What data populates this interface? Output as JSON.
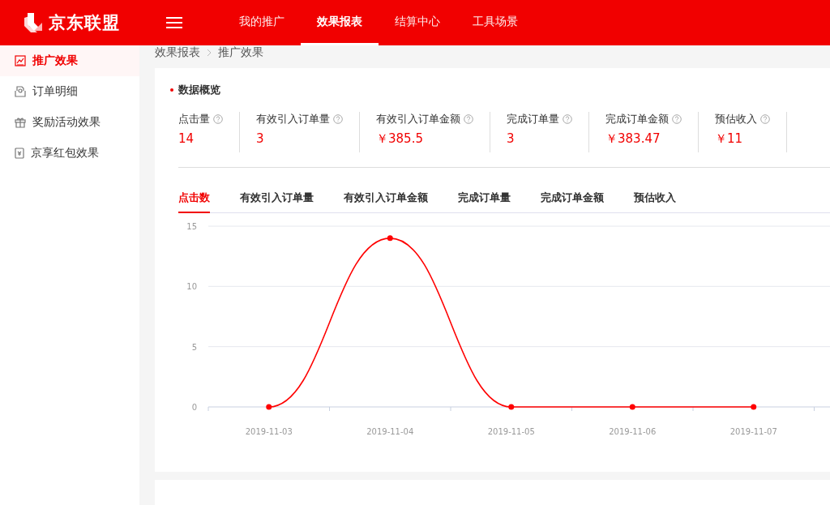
{
  "header": {
    "brand": "京东联盟",
    "nav": [
      {
        "label": "我的推广",
        "selected": false
      },
      {
        "label": "效果报表",
        "selected": true
      },
      {
        "label": "结算中心",
        "selected": false
      },
      {
        "label": "工具场景",
        "selected": false
      }
    ]
  },
  "sidebar": {
    "items": [
      {
        "label": "推广效果",
        "kind": "chart",
        "selected": true
      },
      {
        "label": "订单明细",
        "kind": "order",
        "selected": false
      },
      {
        "label": "奖励活动效果",
        "kind": "gift",
        "selected": false
      },
      {
        "label": "京享红包效果",
        "kind": "packet",
        "selected": false
      }
    ]
  },
  "breadcrumb": [
    "效果报表",
    "推广效果"
  ],
  "overview": {
    "title": "数据概览",
    "metrics": [
      {
        "label": "点击量",
        "value": "14"
      },
      {
        "label": "有效引入订单量",
        "value": "3"
      },
      {
        "label": "有效引入订单金额",
        "value": "￥385.5"
      },
      {
        "label": "完成订单量",
        "value": "3"
      },
      {
        "label": "完成订单金额",
        "value": "￥383.47"
      },
      {
        "label": "预估收入",
        "value": "￥11"
      }
    ],
    "tabs": [
      {
        "label": "点击数",
        "selected": true
      },
      {
        "label": "有效引入订单量",
        "selected": false
      },
      {
        "label": "有效引入订单金额",
        "selected": false
      },
      {
        "label": "完成订单量",
        "selected": false
      },
      {
        "label": "完成订单金额",
        "selected": false
      },
      {
        "label": "预估收入",
        "selected": false
      }
    ],
    "chart_data": {
      "type": "line",
      "categories": [
        "2019-11-03",
        "2019-11-04",
        "2019-11-05",
        "2019-11-06",
        "2019-11-07"
      ],
      "ylim": [
        0,
        15
      ],
      "yticks": [
        0,
        5,
        10,
        15
      ],
      "series": [
        {
          "color": "#ff0000",
          "marker": true,
          "values": [
            0,
            14,
            0,
            0,
            0
          ]
        }
      ]
    }
  }
}
